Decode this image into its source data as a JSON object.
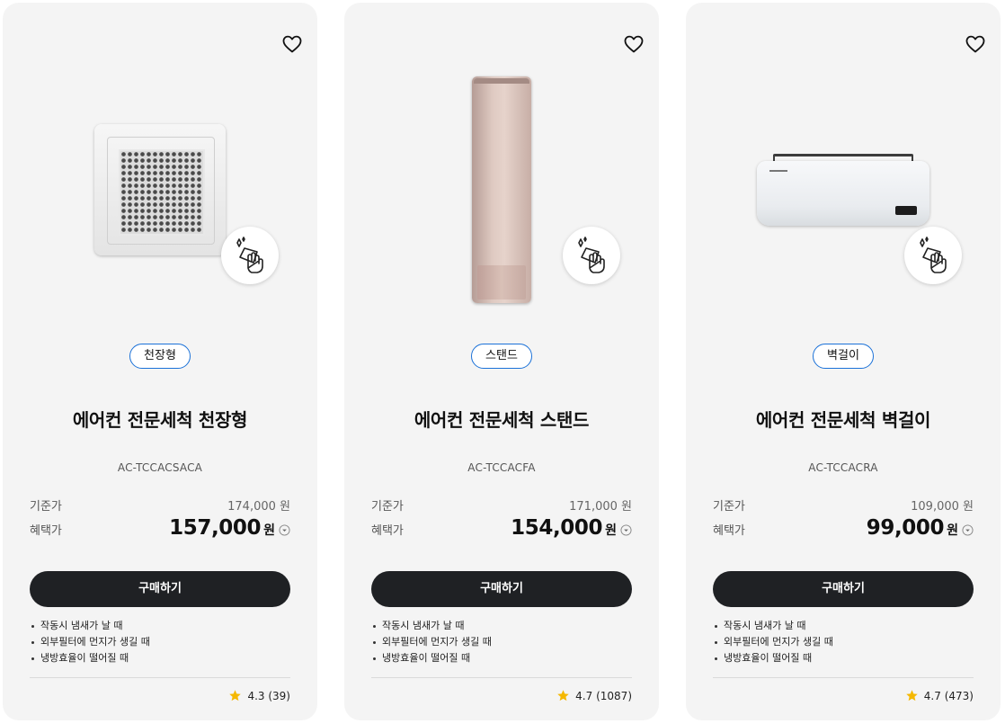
{
  "products": [
    {
      "type_tag": "천장형",
      "title": "에어컨 전문세척 천장형",
      "model": "AC-TCCACSACA",
      "base_label": "기준가",
      "base_price": "174,000 원",
      "sale_label": "혜택가",
      "sale_price": "157,000",
      "currency": "원",
      "buy_label": "구매하기",
      "features": [
        "작동시 냄새가 날 때",
        "외부필터에 먼지가 생길 때",
        "냉방효율이 떨어질 때"
      ],
      "rating": "4.3",
      "reviews": "(39)",
      "image_icon": "cassette-air-conditioner"
    },
    {
      "type_tag": "스탠드",
      "title": "에어컨 전문세척 스탠드",
      "model": "AC-TCCACFA",
      "base_label": "기준가",
      "base_price": "171,000 원",
      "sale_label": "혜택가",
      "sale_price": "154,000",
      "currency": "원",
      "buy_label": "구매하기",
      "features": [
        "작동시 냄새가 날 때",
        "외부필터에 먼지가 생길 때",
        "냉방효율이 떨어질 때"
      ],
      "rating": "4.7",
      "reviews": "(1087)",
      "image_icon": "stand-air-conditioner"
    },
    {
      "type_tag": "벽걸이",
      "title": "에어컨 전문세척 벽걸이",
      "model": "AC-TCCACRA",
      "base_label": "기준가",
      "base_price": "109,000 원",
      "sale_label": "혜택가",
      "sale_price": "99,000",
      "currency": "원",
      "buy_label": "구매하기",
      "features": [
        "작동시 냄새가 날 때",
        "외부필터에 먼지가 생길 때",
        "냉방효율이 떨어질 때"
      ],
      "rating": "4.7",
      "reviews": "(473)",
      "image_icon": "wall-air-conditioner"
    }
  ],
  "icons": {
    "wishlist": "heart-icon",
    "cleaning": "cleaning-hand-icon",
    "price_info": "chevron-down-circle-icon",
    "rating": "star-icon"
  },
  "colors": {
    "card_bg": "#f4f4f4",
    "button_bg": "#1f2124",
    "tag_border": "#1a71d8",
    "star": "#f5b800"
  }
}
